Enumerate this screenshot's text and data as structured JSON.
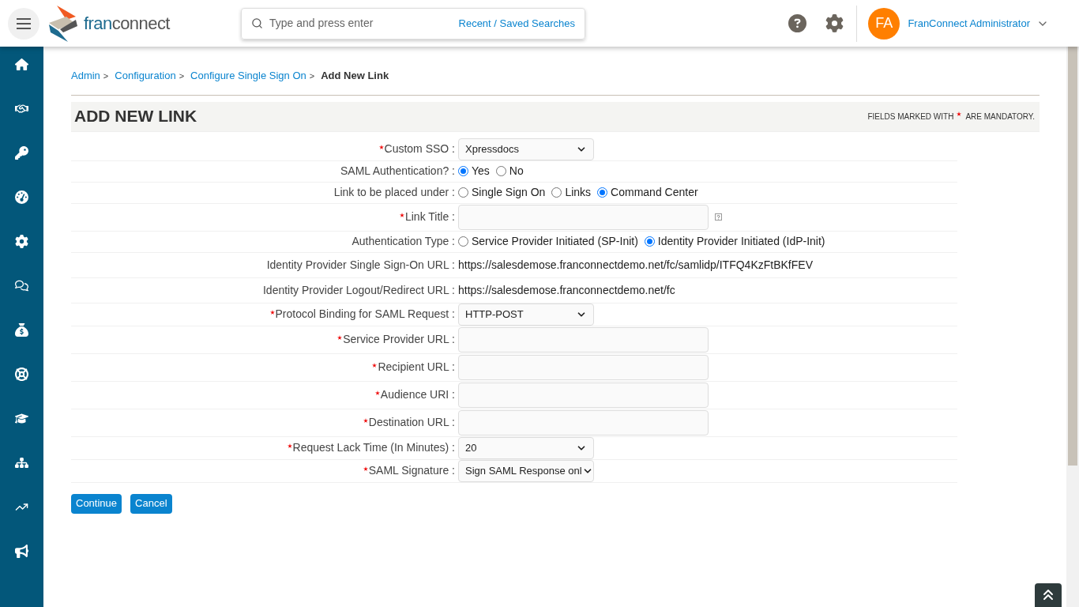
{
  "header": {
    "logo": [
      "fran",
      "connect"
    ],
    "search": {
      "placeholder": "Type and press enter",
      "link": "Recent / Saved Searches"
    },
    "user": {
      "initials": "FA",
      "name": "FranConnect Administrator"
    }
  },
  "breadcrumb": {
    "links": [
      "Admin",
      "Configuration",
      "Configure Single Sign On"
    ],
    "separator": ">",
    "current": "Add New Link"
  },
  "form": {
    "title": "ADD NEW LINK",
    "note_before": "FIELDS MARKED WITH",
    "note_after": "ARE MANDATORY.",
    "rows": [
      {
        "kind": "select",
        "label": "Custom SSO :",
        "required": true,
        "value": "Xpressdocs"
      },
      {
        "kind": "radio",
        "label": "SAML Authentication? :",
        "required": false,
        "options": [
          {
            "label": "Yes",
            "selected": true
          },
          {
            "label": "No",
            "selected": false
          }
        ]
      },
      {
        "kind": "radio",
        "label": "Link to be placed under :",
        "required": false,
        "options": [
          {
            "label": "Single Sign On",
            "selected": false
          },
          {
            "label": "Links",
            "selected": false
          },
          {
            "label": "Command Center",
            "selected": true
          }
        ]
      },
      {
        "kind": "text",
        "label": "Link Title :",
        "required": true,
        "help": true
      },
      {
        "kind": "radio",
        "label": "Authentication Type :",
        "required": false,
        "options": [
          {
            "label": "Service Provider Initiated (SP-Init)",
            "selected": false
          },
          {
            "label": "Identity Provider Initiated (IdP-Init)",
            "selected": true
          }
        ]
      },
      {
        "kind": "static",
        "label": "Identity Provider Single Sign-On URL :",
        "required": false,
        "value": "https://salesdemose.franconnectdemo.net/fc/samlidp/ITFQ4KzFtBKfFEV"
      },
      {
        "kind": "static",
        "label": "Identity Provider Logout/Redirect URL :",
        "required": false,
        "value": "https://salesdemose.franconnectdemo.net/fc"
      },
      {
        "kind": "select",
        "label": "Protocol Binding for SAML Request :",
        "required": true,
        "value": "HTTP-POST"
      },
      {
        "kind": "text",
        "label": "Service Provider URL :",
        "required": true,
        "help": false
      },
      {
        "kind": "text",
        "label": "Recipient URL :",
        "required": true,
        "help": false
      },
      {
        "kind": "text",
        "label": "Audience URI :",
        "required": true,
        "help": false
      },
      {
        "kind": "text",
        "label": "Destination URL :",
        "required": true,
        "help": false
      },
      {
        "kind": "select",
        "label": "Request Lack Time (In Minutes) :",
        "required": true,
        "value": "20"
      },
      {
        "kind": "select",
        "label": "SAML Signature :",
        "required": true,
        "value": "Sign SAML Response onl"
      }
    ],
    "buttons": [
      "Continue",
      "Cancel"
    ]
  }
}
